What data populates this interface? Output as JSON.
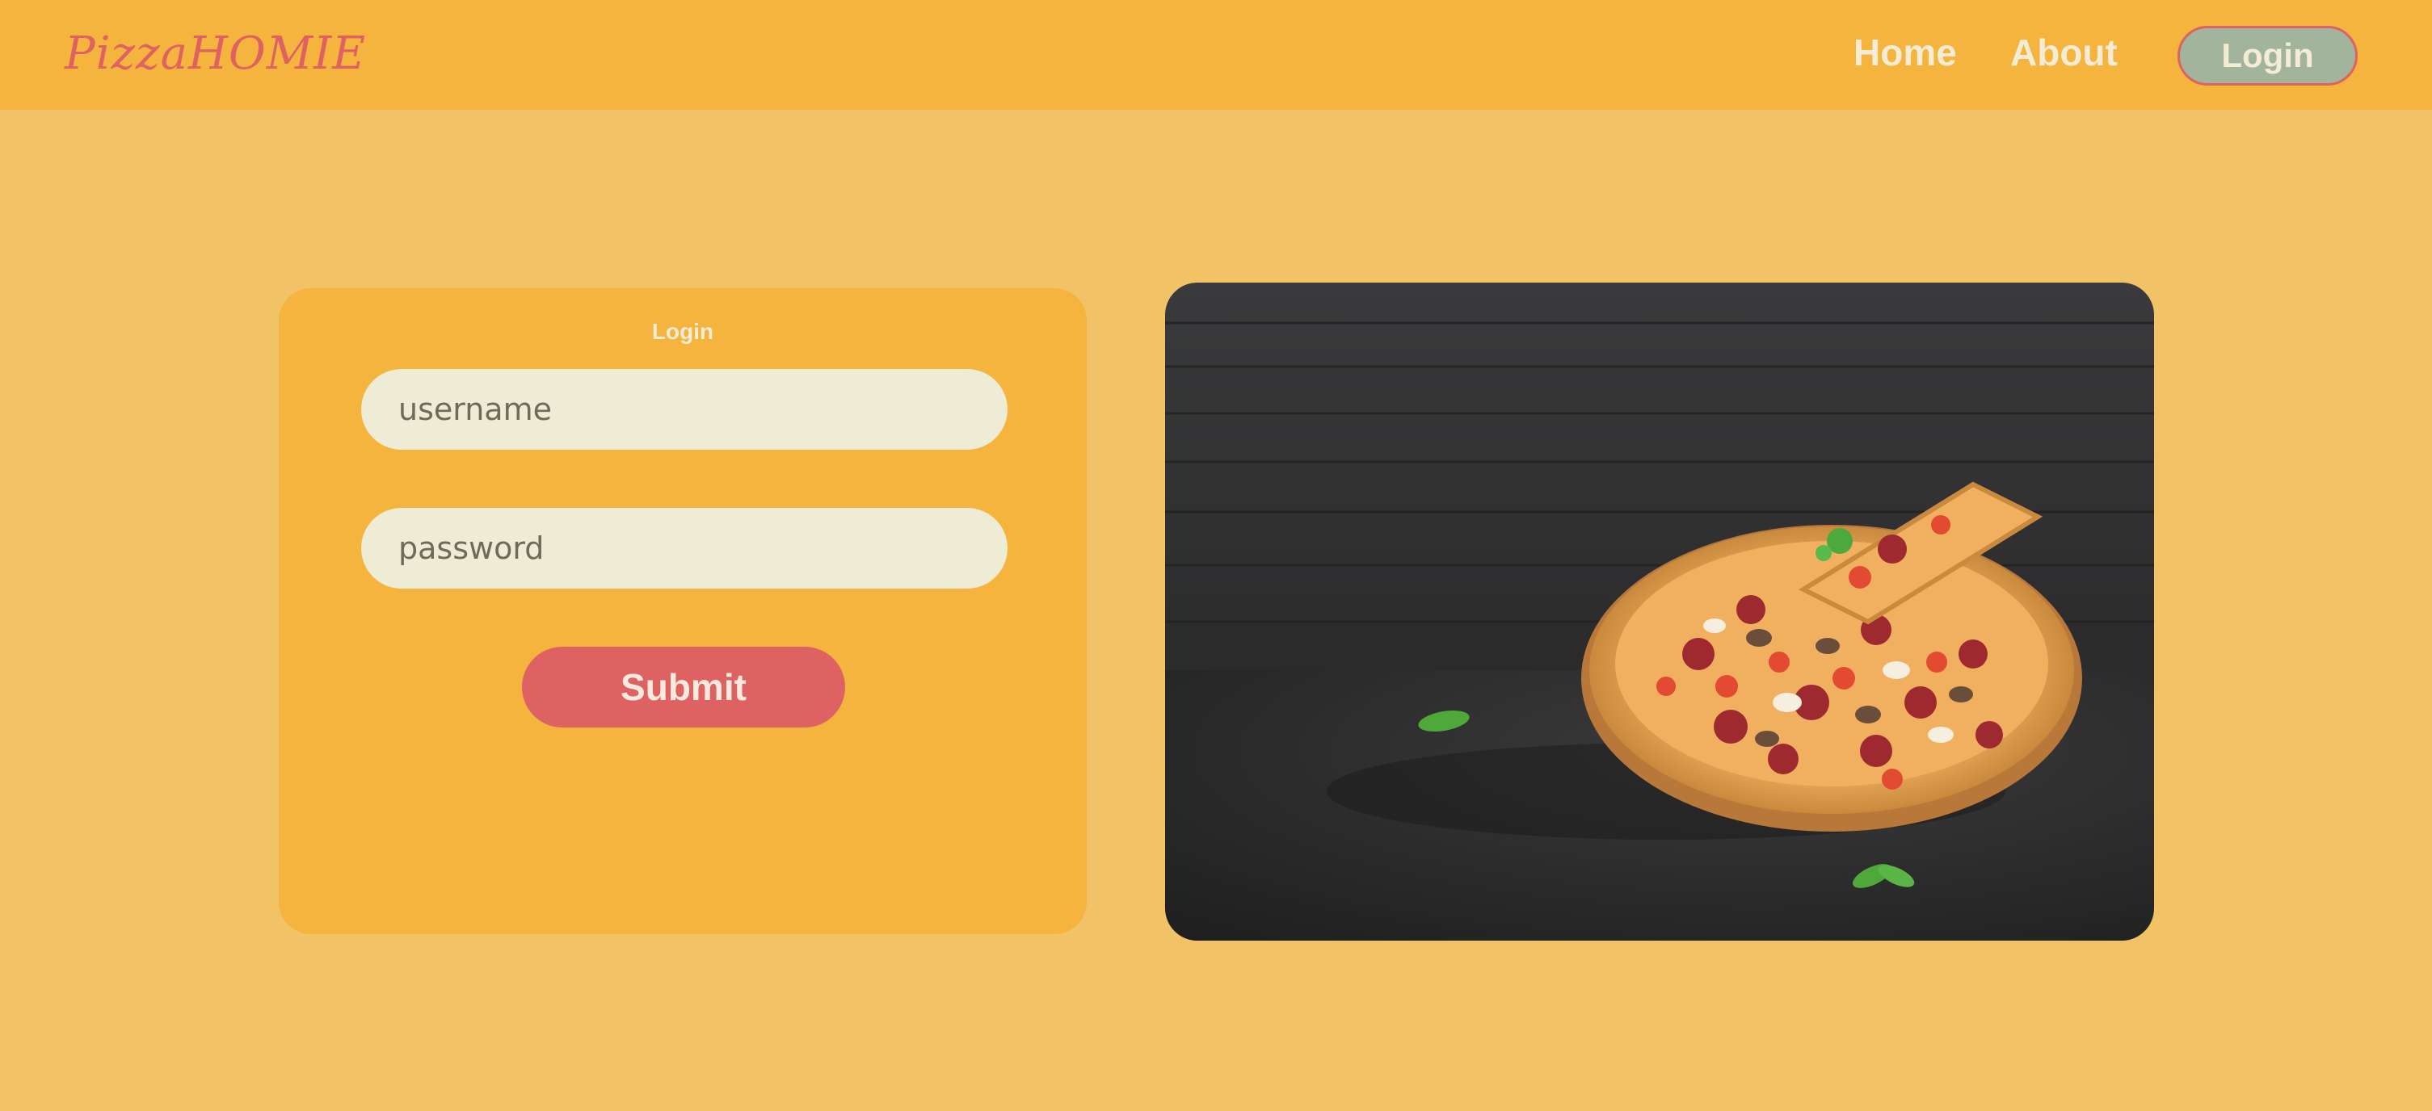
{
  "navbar": {
    "brand": "PizzaHOMIE",
    "links": [
      {
        "label": "Home"
      },
      {
        "label": "About"
      }
    ],
    "login_button": "Login"
  },
  "login_form": {
    "title": "Login",
    "username_placeholder": "username",
    "password_placeholder": "password",
    "submit_label": "Submit"
  },
  "hero_image": {
    "subject": "pepperoni-mushroom-pizza-with-slice-lifted"
  },
  "colors": {
    "page_bg": "#f2c366",
    "nav_bg": "#f4b43e",
    "accent": "#de6262",
    "login_button_bg": "#a2b59c",
    "input_bg": "#eeecd4",
    "text_light": "#f5ecd6"
  }
}
